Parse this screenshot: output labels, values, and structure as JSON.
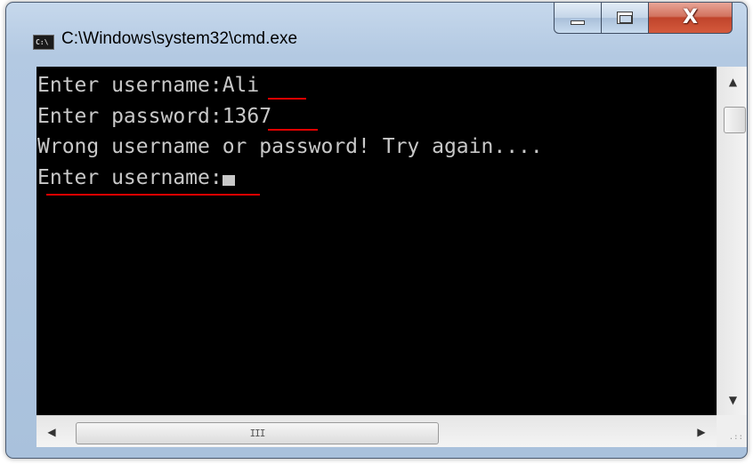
{
  "window": {
    "title": "C:\\Windows\\system32\\cmd.exe",
    "icon_text": "C:\\",
    "controls": {
      "minimize_icon": "minimize-icon",
      "maximize_icon": "maximize-icon",
      "close_label": "X"
    }
  },
  "console": {
    "lines": [
      "Enter username:Ali",
      "Enter password:1367",
      "Wrong username or password! Try again....",
      "Enter username:"
    ],
    "cursor": "block-cursor",
    "annotation_color": "#e00000"
  },
  "scrollbars": {
    "vertical": {
      "up_icon": "arrow-up-icon",
      "down_icon": "arrow-down-icon"
    },
    "horizontal": {
      "left_icon": "arrow-left-icon",
      "right_icon": "arrow-right-icon",
      "grip": "III"
    }
  }
}
